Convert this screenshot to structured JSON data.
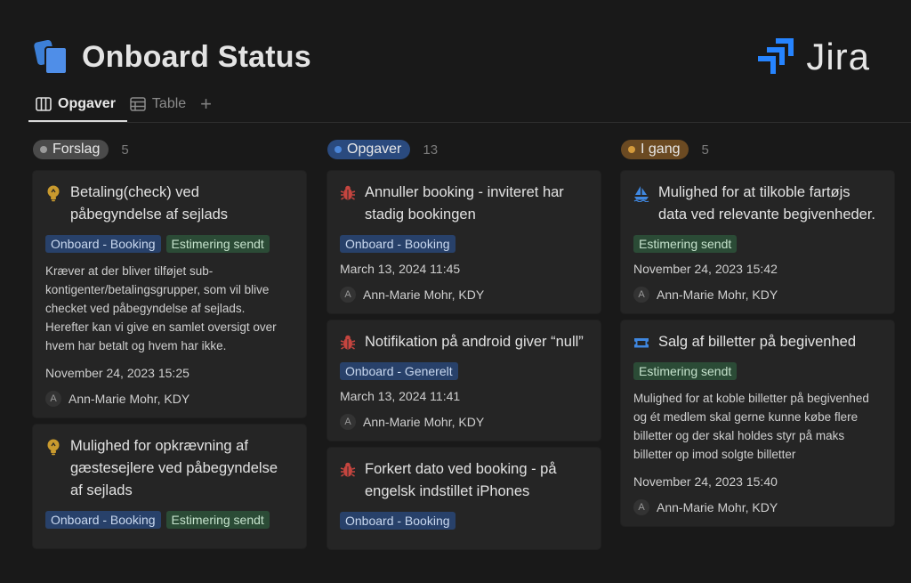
{
  "page": {
    "title": "Onboard Status"
  },
  "brand": {
    "name": "Jira",
    "color": "#2684ff"
  },
  "tabs": [
    {
      "label": "Opgaver",
      "icon": "board-icon",
      "active": true
    },
    {
      "label": "Table",
      "icon": "table-icon",
      "active": false
    }
  ],
  "add_tab": "+",
  "columns": [
    {
      "name": "Forslag",
      "count": "5",
      "color": "#5a5a5a",
      "dot": "#9b9b9b",
      "cards": [
        {
          "icon": "lightbulb-icon",
          "title": "Betaling(check) ved påbegyndelse af sejlads",
          "tags": [
            {
              "label": "Onboard - Booking",
              "color": "blue"
            },
            {
              "label": "Estimering sendt",
              "color": "green"
            }
          ],
          "description": "Kræver at der bliver tilføjet sub-kontigenter/betalingsgrupper, som vil blive checket ved påbegyndelse af sejlads.\nHerefter kan vi give en samlet oversigt over hvem har betalt og hvem har ikke.",
          "date": "November 24, 2023 15:25",
          "person": "Ann-Marie Mohr, KDY",
          "avatar": "A"
        },
        {
          "icon": "lightbulb-icon",
          "title": "Mulighed for opkrævning af gæstesejlere ved påbegyndelse af sejlads",
          "tags": [
            {
              "label": "Onboard - Booking",
              "color": "blue"
            },
            {
              "label": "Estimering sendt",
              "color": "green"
            }
          ]
        }
      ]
    },
    {
      "name": "Opgaver",
      "count": "13",
      "color": "#2a4a7e",
      "dot": "#4b86d8",
      "cards": [
        {
          "icon": "bug-icon",
          "title": "Annuller booking - inviteret har stadig bookingen",
          "tags": [
            {
              "label": "Onboard - Booking",
              "color": "blue"
            }
          ],
          "date": "March 13, 2024 11:45",
          "person": "Ann-Marie Mohr, KDY",
          "avatar": "A"
        },
        {
          "icon": "bug-icon",
          "title": "Notifikation på android giver “null”",
          "tags": [
            {
              "label": "Onboard - Generelt",
              "color": "blue"
            }
          ],
          "date": "March 13, 2024 11:41",
          "person": "Ann-Marie Mohr, KDY",
          "avatar": "A"
        },
        {
          "icon": "bug-icon",
          "title": "Forkert dato ved booking - på engelsk indstillet iPhones",
          "tags": [
            {
              "label": "Onboard - Booking",
              "color": "blue"
            }
          ]
        }
      ]
    },
    {
      "name": "I gang",
      "count": "5",
      "color": "#6b4a22",
      "dot": "#d49b3c",
      "cards": [
        {
          "icon": "ship-icon",
          "title": "Mulighed for at tilkoble fartøjs data ved relevante begivenheder.",
          "tags": [
            {
              "label": "Estimering sendt",
              "color": "green"
            }
          ],
          "date": "November 24, 2023 15:42",
          "person": "Ann-Marie Mohr, KDY",
          "avatar": "A"
        },
        {
          "icon": "ticket-icon",
          "title": "Salg af billetter på begivenhed",
          "tags": [
            {
              "label": "Estimering sendt",
              "color": "green"
            }
          ],
          "description": "Mulighed for at koble billetter på begivenhed og ét medlem skal gerne kunne købe flere billetter og der skal holdes styr på maks billetter op imod solgte billetter",
          "date": "November 24, 2023 15:40",
          "person": "Ann-Marie Mohr, KDY",
          "avatar": "A"
        }
      ]
    }
  ]
}
